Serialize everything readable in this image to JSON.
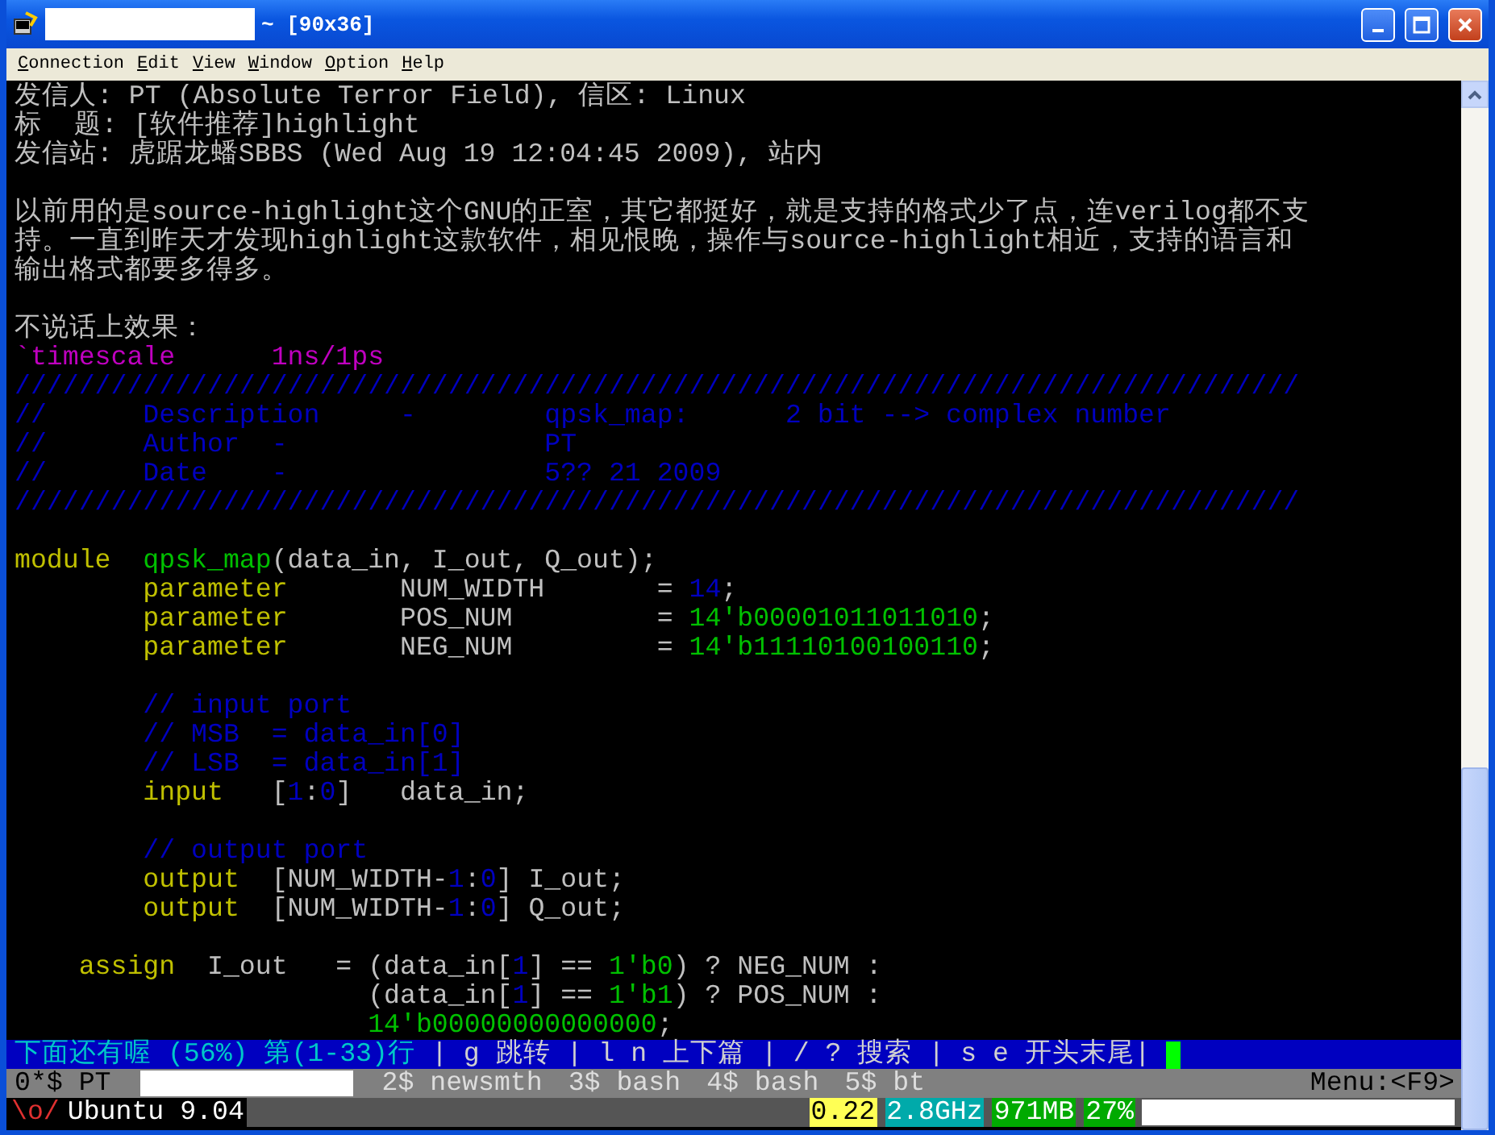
{
  "window": {
    "title": "~ [90x36]"
  },
  "menu": [
    "Connection",
    "Edit",
    "View",
    "Window",
    "Option",
    "Help"
  ],
  "lines": [
    {
      "segments": [
        {
          "text": "发信人: PT (Absolute Terror Field), 信区: Linux",
          "color": "#c0c0c0"
        }
      ]
    },
    {
      "segments": [
        {
          "text": "标  题: [软件推荐]highlight",
          "color": "#c0c0c0"
        }
      ]
    },
    {
      "segments": [
        {
          "text": "发信站: 虎踞龙蟠SBBS (Wed Aug 19 12:04:45 2009), 站内",
          "color": "#c0c0c0"
        }
      ]
    },
    {
      "kind": "blank"
    },
    {
      "segments": [
        {
          "text": "以前用的是source-highlight这个GNU的正室，其它都挺好，就是支持的格式少了点，连verilog都不支",
          "color": "#c0c0c0"
        }
      ]
    },
    {
      "segments": [
        {
          "text": "持。一直到昨天才发现highlight这款软件，相见恨晚，操作与source-highlight相近，支持的语言和",
          "color": "#c0c0c0"
        }
      ]
    },
    {
      "segments": [
        {
          "text": "输出格式都要多得多。",
          "color": "#c0c0c0"
        }
      ]
    },
    {
      "kind": "blank"
    },
    {
      "segments": [
        {
          "text": "不说话上效果：",
          "color": "#c0c0c0"
        }
      ]
    },
    {
      "segments": [
        {
          "text": "`timescale      1ns/1ps",
          "color": "#c000c0"
        }
      ]
    },
    {
      "segments": [
        {
          "text": "////////////////////////////////////////////////////////////////////////////////",
          "color": "#0000c0"
        }
      ]
    },
    {
      "segments": [
        {
          "text": "//      Description     -        qpsk_map:      2 bit --> complex number",
          "color": "#0000c0"
        }
      ]
    },
    {
      "segments": [
        {
          "text": "//      Author  -                PT",
          "color": "#0000c0"
        }
      ]
    },
    {
      "segments": [
        {
          "text": "//      Date    -                5?? 21 2009",
          "color": "#0000c0"
        }
      ]
    },
    {
      "segments": [
        {
          "text": "////////////////////////////////////////////////////////////////////////////////",
          "color": "#0000c0"
        }
      ]
    },
    {
      "kind": "blank"
    },
    {
      "segments": [
        {
          "text": "module",
          "color": "#c0c000"
        },
        {
          "text": "  qpsk_map",
          "color": "#00c000"
        },
        {
          "text": "(data_in, I_out, Q_out);",
          "color": "#c0c0c0"
        }
      ]
    },
    {
      "segments": [
        {
          "text": "        parameter",
          "color": "#c0c000"
        },
        {
          "text": "       NUM_WIDTH       = ",
          "color": "#c0c0c0"
        },
        {
          "text": "14",
          "color": "#0000c0"
        },
        {
          "text": ";",
          "color": "#c0c0c0"
        }
      ]
    },
    {
      "segments": [
        {
          "text": "        parameter",
          "color": "#c0c000"
        },
        {
          "text": "       POS_NUM         = ",
          "color": "#c0c0c0"
        },
        {
          "text": "14'b00001011011010",
          "color": "#00c000"
        },
        {
          "text": ";",
          "color": "#c0c0c0"
        }
      ]
    },
    {
      "segments": [
        {
          "text": "        parameter",
          "color": "#c0c000"
        },
        {
          "text": "       NEG_NUM         = ",
          "color": "#c0c0c0"
        },
        {
          "text": "14'b11110100100110",
          "color": "#00c000"
        },
        {
          "text": ";",
          "color": "#c0c0c0"
        }
      ]
    },
    {
      "kind": "blank"
    },
    {
      "segments": [
        {
          "text": "        // input port",
          "color": "#0000c0"
        }
      ]
    },
    {
      "segments": [
        {
          "text": "        // MSB  = data_in[0]",
          "color": "#0000c0"
        }
      ]
    },
    {
      "segments": [
        {
          "text": "        // LSB  = data_in[1]",
          "color": "#0000c0"
        }
      ]
    },
    {
      "segments": [
        {
          "text": "        input",
          "color": "#c0c000"
        },
        {
          "text": "   [",
          "color": "#c0c0c0"
        },
        {
          "text": "1",
          "color": "#0000c0"
        },
        {
          "text": ":",
          "color": "#c0c0c0"
        },
        {
          "text": "0",
          "color": "#0000c0"
        },
        {
          "text": "]   data_in;",
          "color": "#c0c0c0"
        }
      ]
    },
    {
      "kind": "blank"
    },
    {
      "segments": [
        {
          "text": "        // output port",
          "color": "#0000c0"
        }
      ]
    },
    {
      "segments": [
        {
          "text": "        output",
          "color": "#c0c000"
        },
        {
          "text": "  [NUM_WIDTH-",
          "color": "#c0c0c0"
        },
        {
          "text": "1",
          "color": "#0000c0"
        },
        {
          "text": ":",
          "color": "#c0c0c0"
        },
        {
          "text": "0",
          "color": "#0000c0"
        },
        {
          "text": "] I_out;",
          "color": "#c0c0c0"
        }
      ]
    },
    {
      "segments": [
        {
          "text": "        output",
          "color": "#c0c000"
        },
        {
          "text": "  [NUM_WIDTH-",
          "color": "#c0c0c0"
        },
        {
          "text": "1",
          "color": "#0000c0"
        },
        {
          "text": ":",
          "color": "#c0c0c0"
        },
        {
          "text": "0",
          "color": "#0000c0"
        },
        {
          "text": "] Q_out;",
          "color": "#c0c0c0"
        }
      ]
    },
    {
      "kind": "blank"
    },
    {
      "segments": [
        {
          "text": "    assign",
          "color": "#c0c000"
        },
        {
          "text": "  I_out   = (data_in[",
          "color": "#c0c0c0"
        },
        {
          "text": "1",
          "color": "#0000c0"
        },
        {
          "text": "] == ",
          "color": "#c0c0c0"
        },
        {
          "text": "1'b0",
          "color": "#00c000"
        },
        {
          "text": ") ? NEG_NUM :",
          "color": "#c0c0c0"
        }
      ]
    },
    {
      "segments": [
        {
          "text": "                      (data_in[",
          "color": "#c0c0c0"
        },
        {
          "text": "1",
          "color": "#0000c0"
        },
        {
          "text": "] == ",
          "color": "#c0c0c0"
        },
        {
          "text": "1'b1",
          "color": "#00c000"
        },
        {
          "text": ") ? POS_NUM :",
          "color": "#c0c0c0"
        }
      ]
    },
    {
      "segments": [
        {
          "text": "                      14'b00000000000000",
          "color": "#00c000"
        },
        {
          "text": ";",
          "color": "#c0c0c0"
        }
      ]
    }
  ],
  "pager": [
    {
      "text": "下面还有喔 (56%) 第(1-33)行",
      "kind": "position"
    },
    {
      "text": "| g 跳转 | l n 上下篇 | / ? 搜索 | s e 开头末尾|",
      "kind": "keys"
    }
  ],
  "tmux_windows": [
    {
      "label": "0*$ PT",
      "selected": true
    },
    {
      "label": "2$ newsmth",
      "selected": false
    },
    {
      "label": "3$ bash",
      "selected": false
    },
    {
      "label": "4$ bash",
      "selected": false
    },
    {
      "label": "5$ bt",
      "selected": false
    }
  ],
  "tmux_menu": "Menu:<F9>",
  "status": {
    "logo": "\\o/",
    "host": "Ubuntu 9.04",
    "badges": [
      {
        "text": "0.22",
        "color": "#ffff55"
      },
      {
        "text": "2.8GHz",
        "color": "#00aaaa"
      },
      {
        "text": "971MB",
        "color": "#00aa00"
      },
      {
        "text": "27%",
        "color": "#00aa00"
      }
    ]
  }
}
